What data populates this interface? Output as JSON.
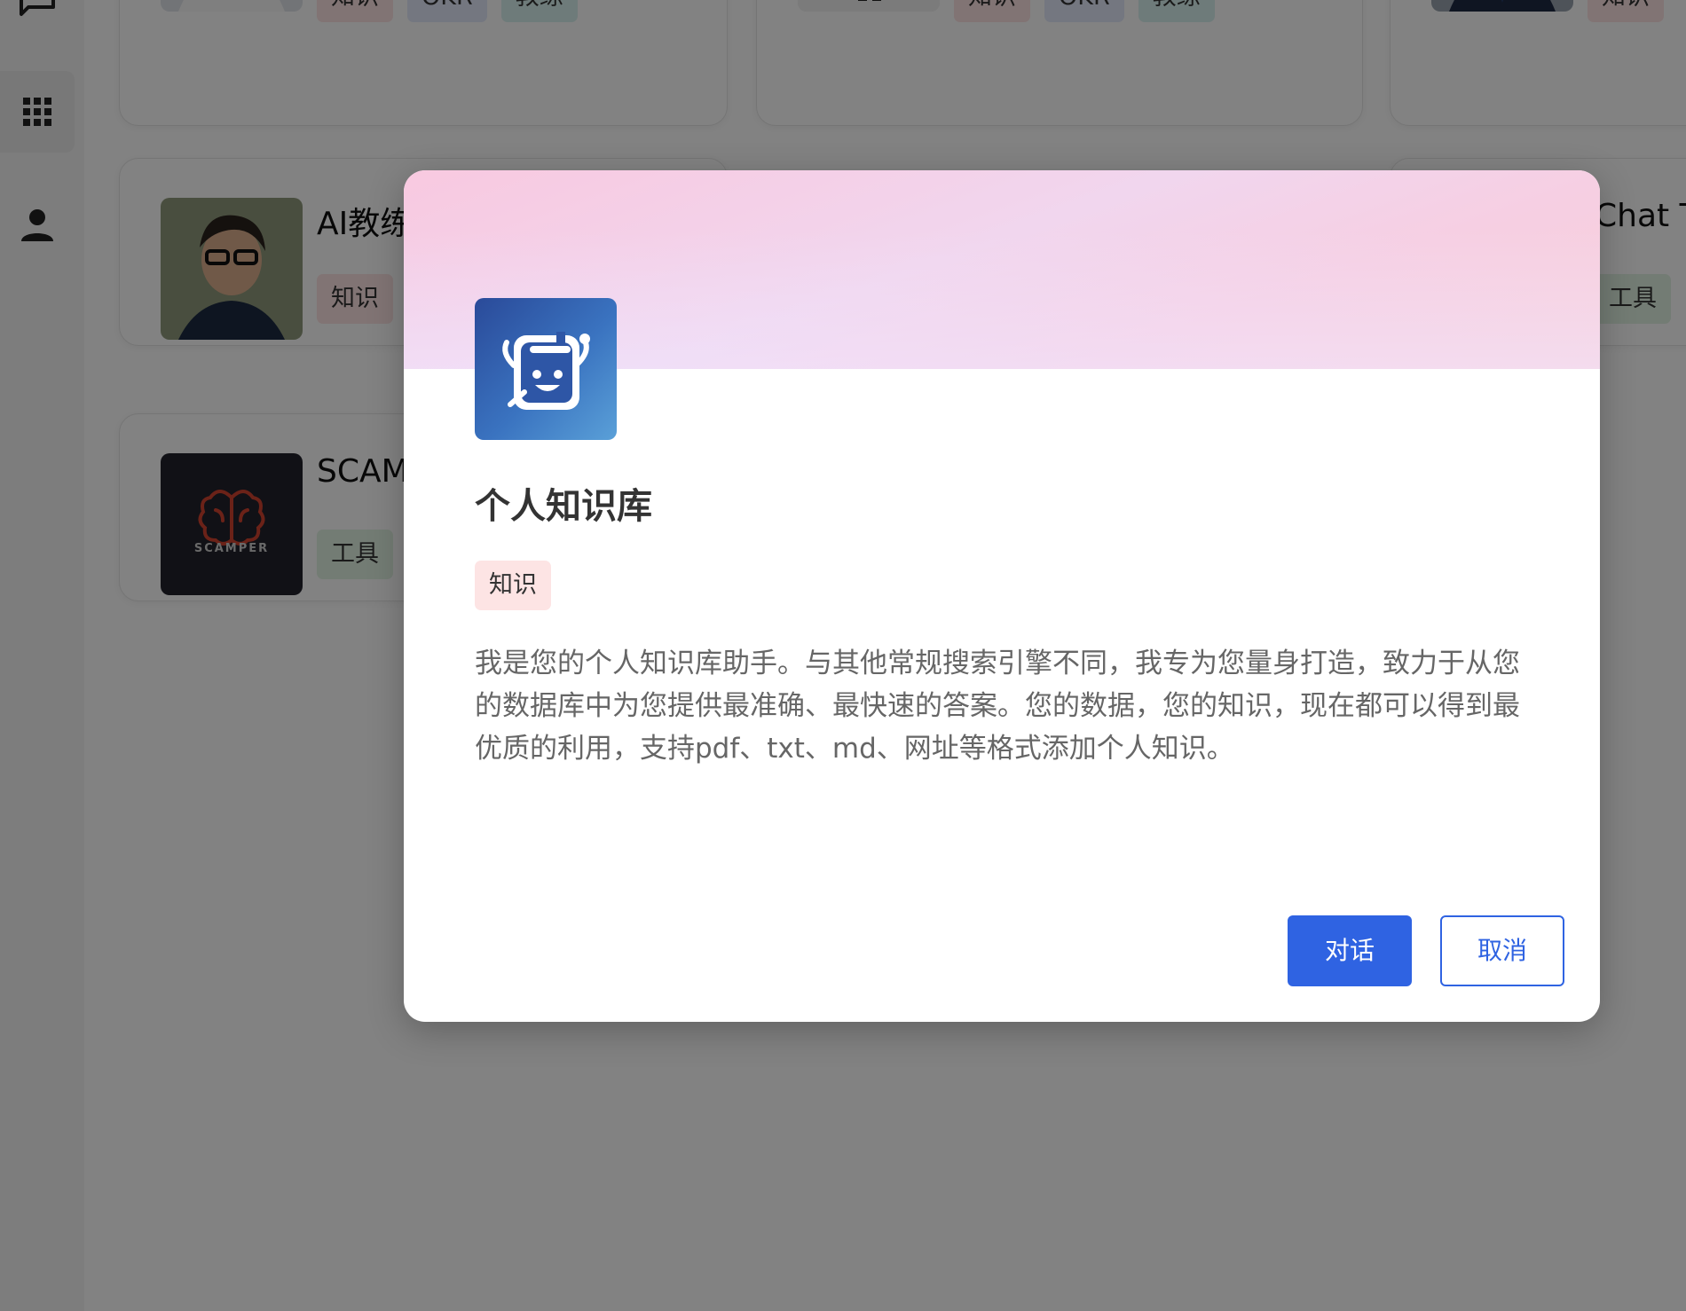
{
  "nav": {
    "items": [
      {
        "icon": "chat-icon"
      },
      {
        "icon": "grid-icon",
        "active": true
      },
      {
        "icon": "person-icon"
      }
    ]
  },
  "cards": [
    {
      "title": "",
      "tags": [
        "知识",
        "OKR",
        "教练"
      ]
    },
    {
      "title": "",
      "tags": [
        "知识",
        "OKR",
        "教练"
      ]
    },
    {
      "title": "",
      "tags": [
        "知识"
      ]
    },
    {
      "title": "AI教练",
      "tags": [
        "知识"
      ]
    },
    {
      "title": "Chat Tr",
      "tags": [
        "工具"
      ]
    },
    {
      "title": "SCAM",
      "tags": [
        "工具"
      ]
    }
  ],
  "scamper_logo_text": "SCAMPER",
  "modal": {
    "title": "个人知识库",
    "tag": "知识",
    "description": "我是您的个人知识库助手。与其他常规搜索引擎不同，我专为您量身打造，致力于从您的数据库中为您提供最准确、最快速的答案。您的数据，您的知识，现在都可以得到最优质的利用，支持pdf、txt、md、网址等格式添加个人知识。",
    "chat_button": "对话",
    "cancel_button": "取消"
  },
  "colors": {
    "primary": "#2f63e2",
    "tag_knowledge": "#fde4e4",
    "tag_okr": "#e3e9fb",
    "tag_coach": "#d8f1ef",
    "tag_tool": "#e1f3e3"
  }
}
